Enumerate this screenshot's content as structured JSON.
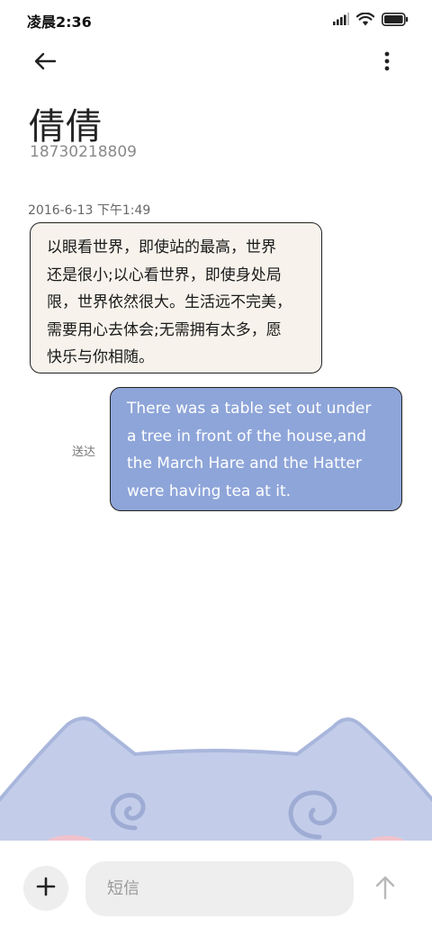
{
  "status_bar": {
    "time": "凌晨2:36",
    "icons": [
      "signal-icon",
      "wifi-icon",
      "battery-icon"
    ]
  },
  "header": {
    "back_icon": "arrow-left-icon",
    "more_icon": "more-vertical-icon",
    "contact_name": "倩倩",
    "contact_phone": "18730218809"
  },
  "conversation": {
    "timestamp": "2016-6-13 下午1:49",
    "messages": [
      {
        "direction": "incoming",
        "lines": [
          "以眼看世界，即使站的最高，世界",
          "还是很小;以心看世界，即使身处局",
          "限，世界依然很大。生活远不完美，",
          "需要用心去体会;无需拥有太多，愿",
          "快乐与你相随。"
        ]
      },
      {
        "direction": "outgoing",
        "status": "送达",
        "lines": [
          "There was a table set out under",
          "a tree in front of the house,and",
          "the March Hare and the Hatter",
          "were having tea at it."
        ]
      }
    ]
  },
  "composer": {
    "add_icon": "plus-icon",
    "placeholder": "短信",
    "send_icon": "arrow-up-icon"
  },
  "colors": {
    "incoming_bubble": "#f7f3ec",
    "outgoing_bubble": "#8ea5d9",
    "wallpaper_cat": "#c3cdea"
  }
}
